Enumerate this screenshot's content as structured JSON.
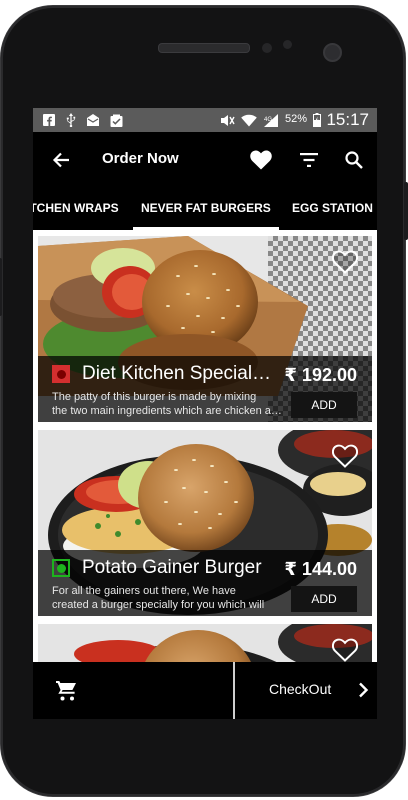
{
  "status_bar": {
    "time": "15:17",
    "battery_percent": "52%",
    "icons": [
      "facebook-icon",
      "usb-icon",
      "mail-icon",
      "task-icon",
      "mute-icon",
      "wifi-icon",
      "signal-icon",
      "battery-icon"
    ]
  },
  "app_bar": {
    "title": "Order Now",
    "icons": [
      "back-arrow-icon",
      "heart-icon",
      "filter-icon",
      "search-icon"
    ]
  },
  "tabs": [
    {
      "label": "ITCHEN WRAPS",
      "selected": false
    },
    {
      "label": "NEVER FAT BURGERS",
      "selected": true
    },
    {
      "label": "EGG STATION",
      "selected": false
    }
  ],
  "menu_items": [
    {
      "name": "Diet Kitchen Special Burger",
      "type": "non-veg",
      "price": "₹ 192.00",
      "description_line1": "The patty of this burger is made by mixing",
      "description_line2": "the two main ingredients which are chicken and",
      "add_label": "ADD"
    },
    {
      "name": "Potato Gainer Burger",
      "type": "veg",
      "price": "₹ 144.00",
      "description_line1": "For all the gainers out there, We have",
      "description_line2": "created a burger specially for you which will",
      "add_label": "ADD"
    }
  ],
  "bottom_bar": {
    "checkout_label": "CheckOut",
    "icons": [
      "cart-icon",
      "chevron-right-icon"
    ]
  },
  "colors": {
    "non_veg": "#d32f2f",
    "veg": "#1db31d",
    "status_bar": "#5b5b5b",
    "app_bar": "#000000"
  }
}
